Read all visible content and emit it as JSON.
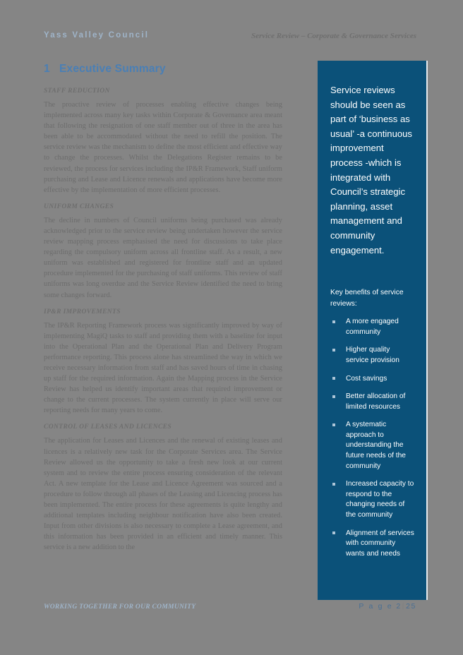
{
  "header": {
    "organisation": "Yass Valley Council",
    "document_title": "Service Review – Corporate & Governance Services"
  },
  "heading": {
    "number": "1",
    "title": "Executive Summary"
  },
  "body": {
    "sections": [
      {
        "heading": "STAFF REDUCTION",
        "text": "The proactive review of processes enabling effective changes being implemented across many key tasks within Corporate & Governance area meant that following the resignation of one staff member out of three in the area has been able to be accommodated without the need to refill the position.  The service review was the mechanism to define the most efficient and effective way to change the processes. Whilst the Delegations Register remains to be reviewed, the process for services including the IP&R Framework, Staff uniform purchasing and Lease and Licence renewals and applications have become more effective by the implementation of more efficient processes."
      },
      {
        "heading": "UNIFORM CHANGES",
        "text": "The decline in numbers of Council uniforms being purchased was already acknowledged prior to the service review being undertaken however the service review mapping process emphasised the need for discussions to take place regarding the compulsory uniform across all frontline staff.  As a result, a new uniform was established and registered for frontline staff and an updated procedure implemented for the purchasing of staff uniforms.  This review of staff uniforms was long overdue and the Service Review identified the need to bring some changes forward."
      },
      {
        "heading": "IP&R IMPROVEMENTS",
        "text": "The IP&R Reporting Framework process was significantly improved by way of implementing MagiQ tasks to staff and providing them with a baseline for input into the Operational Plan and the Operational Plan and Delivery Program performance reporting.  This process alone has streamlined the way in which we receive necessary information from staff and has saved hours of time in chasing up staff for the required information.  Again the Mapping process in the Service Review has helped us identify important areas that required improvement or change to the current processes.  The system currently in place will serve our reporting needs for many years to come."
      },
      {
        "heading": "CONTROL OF LEASES AND LICENCES",
        "text": "The application for Leases and Licences and the renewal of existing leases and licences is a relatively new task for the Corporate Services area.  The Service Review allowed us the opportunity to take a fresh new look at our current system and to review the entire process ensuring consideration of the relevant Act.  A new template for the Lease and Licence Agreement was sourced and a procedure to follow through all phases of the Leasing and Licencing process has been implemented.  The entire process for these agreements is quite lengthy and additional templates including neighbour notification have also been created.  Input from other divisions is also necessary to complete a Lease agreement, and this information has been provided in an efficient and timely manner.  This service is a new addition to the"
      }
    ]
  },
  "sidebar": {
    "quote": "Service reviews should be seen as part of ‘business as usual’ -a continuous improvement process -which is integrated with Council’s strategic planning, asset management and community engagement.",
    "benefits_title": "Key benefits of service reviews:",
    "benefits": [
      "A more engaged community",
      "Higher quality service provision",
      "Cost savings",
      "Better allocation of limited resources",
      "A systematic approach to understanding the future needs of the community",
      "Increased capacity to respond to the changing needs of the community",
      "Alignment of services with community wants and needs"
    ],
    "background_color": "#0b5179",
    "text_color": "#ffffff"
  },
  "footer": {
    "tagline": "Working together for our community",
    "page_label": "P a g e",
    "page_current": "2",
    "page_separator": "|",
    "page_total": "25"
  }
}
